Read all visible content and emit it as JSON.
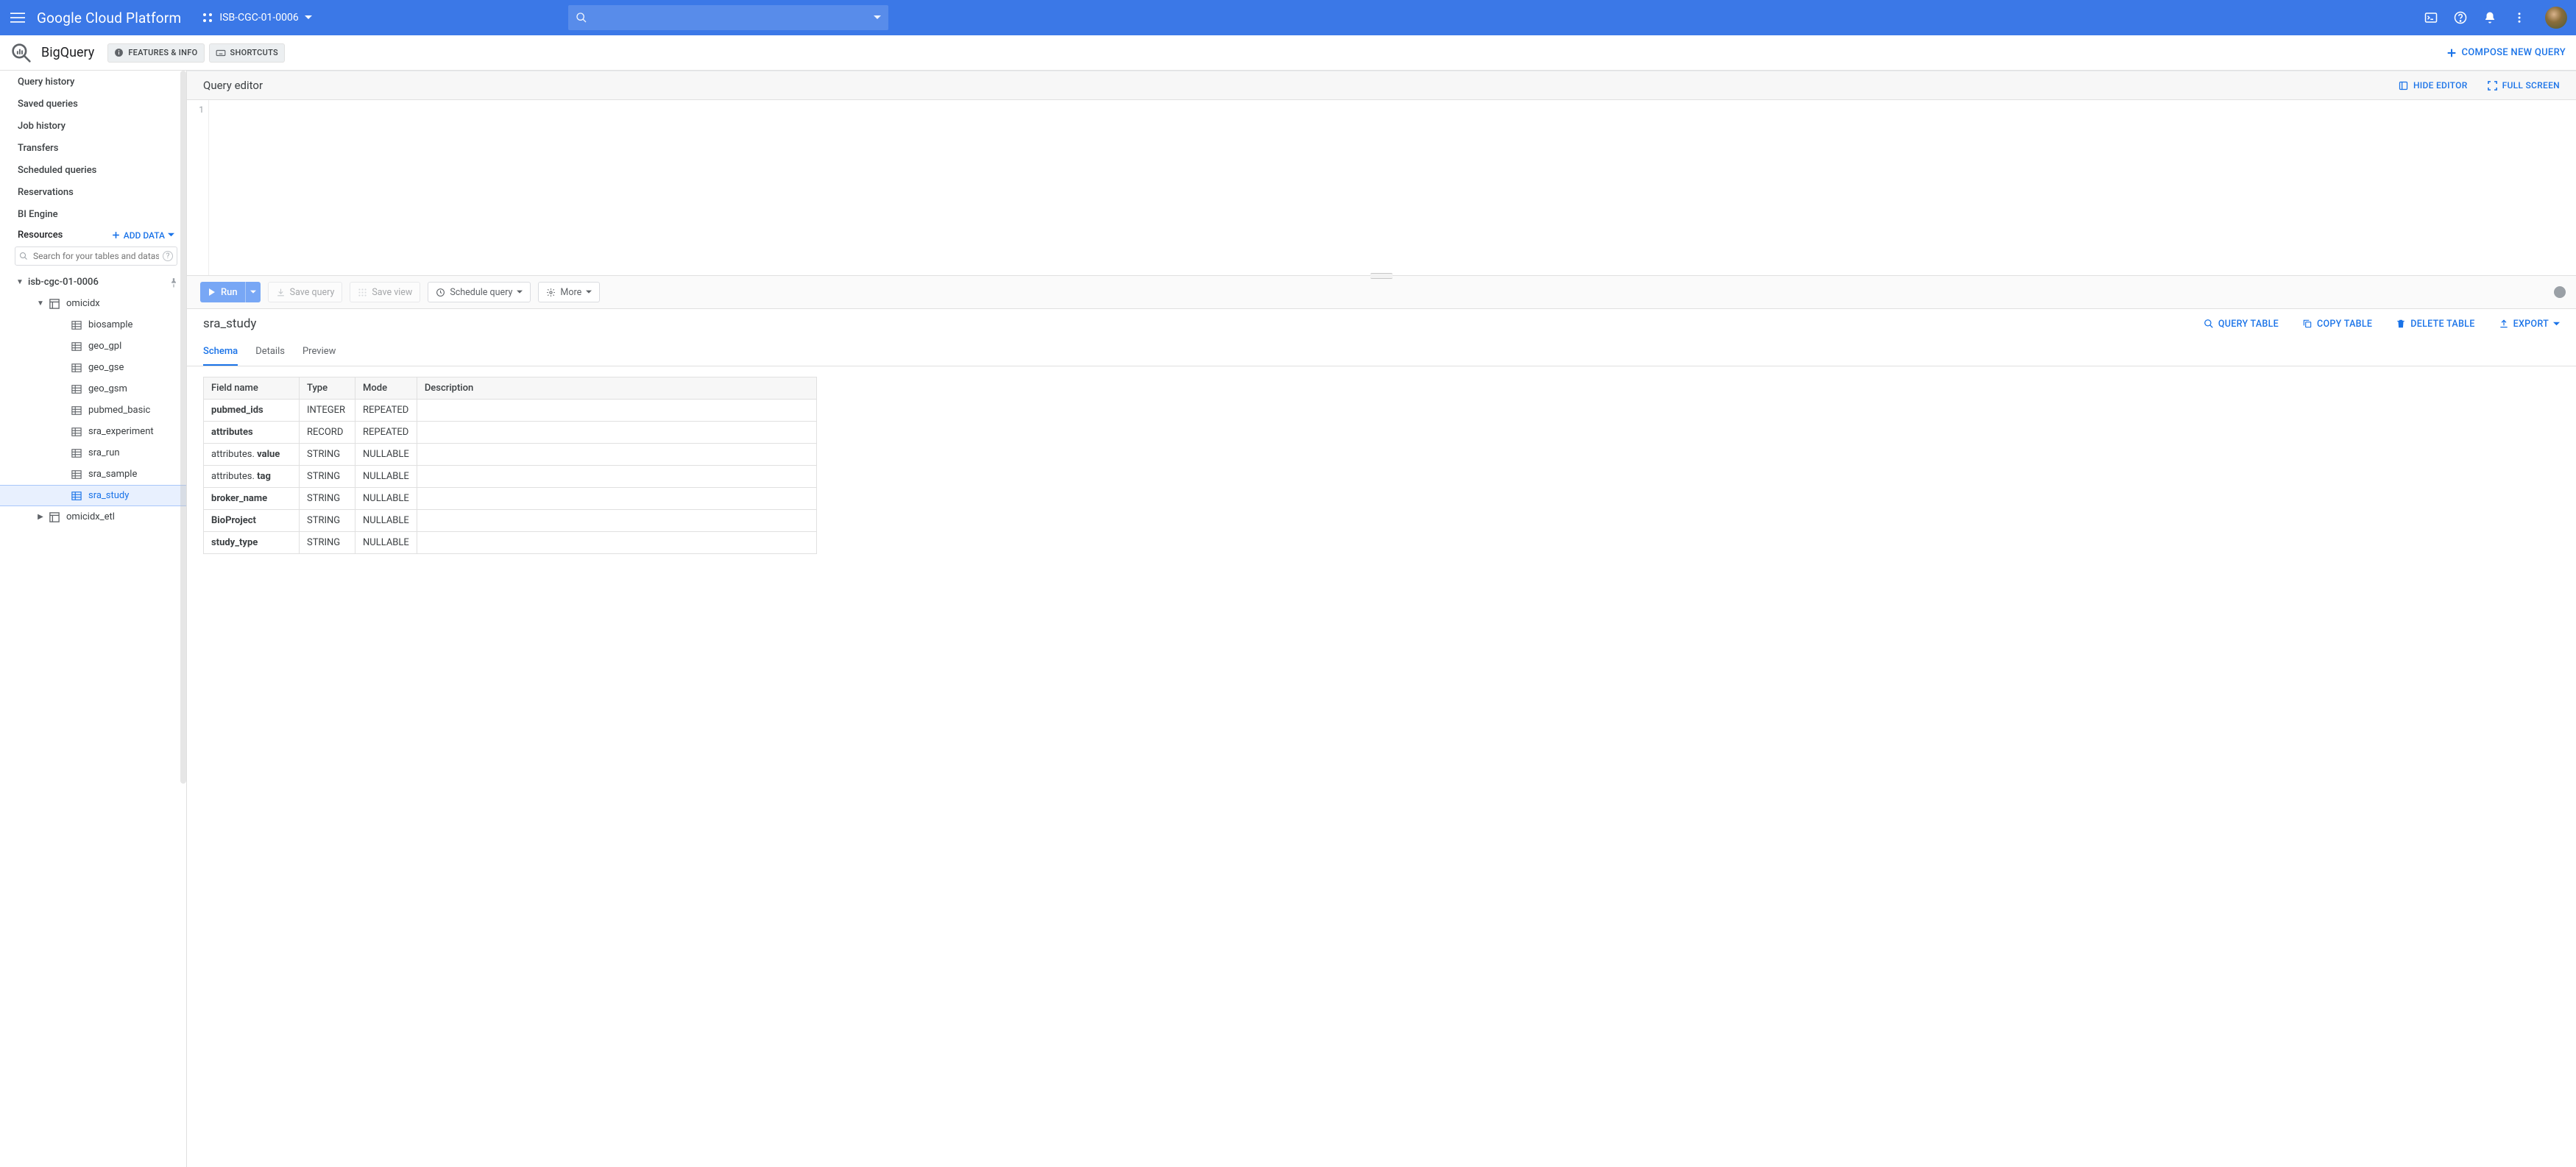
{
  "header": {
    "platform_title": "Google Cloud Platform",
    "project_name": "ISB-CGC-01-0006"
  },
  "service": {
    "title": "BigQuery",
    "features_chip": "FEATURES & INFO",
    "shortcuts_chip": "SHORTCUTS",
    "compose_label": "COMPOSE NEW QUERY"
  },
  "sidebar": {
    "nav": {
      "query_history": "Query history",
      "saved_queries": "Saved queries",
      "job_history": "Job history",
      "transfers": "Transfers",
      "scheduled_queries": "Scheduled queries",
      "reservations": "Reservations",
      "bi_engine": "BI Engine"
    },
    "resources_label": "Resources",
    "add_data_label": "ADD DATA",
    "search_placeholder": "Search for your tables and datas…",
    "tree": {
      "project": "isb-cgc-01-0006",
      "dataset1": "omicidx",
      "tables": {
        "biosample": "biosample",
        "geo_gpl": "geo_gpl",
        "geo_gse": "geo_gse",
        "geo_gsm": "geo_gsm",
        "pubmed_basic": "pubmed_basic",
        "sra_experiment": "sra_experiment",
        "sra_run": "sra_run",
        "sra_sample": "sra_sample",
        "sra_study": "sra_study"
      },
      "dataset2": "omicidx_etl"
    }
  },
  "editor": {
    "title": "Query editor",
    "hide_label": "HIDE EDITOR",
    "fullscreen_label": "FULL SCREEN",
    "line1": "1"
  },
  "toolbar": {
    "run": "Run",
    "save_query": "Save query",
    "save_view": "Save view",
    "schedule": "Schedule query",
    "more": "More"
  },
  "table_panel": {
    "title": "sra_study",
    "query_table": "QUERY TABLE",
    "copy_table": "COPY TABLE",
    "delete_table": "DELETE TABLE",
    "export": "EXPORT",
    "tabs": {
      "schema": "Schema",
      "details": "Details",
      "preview": "Preview"
    },
    "columns": {
      "field": "Field name",
      "type": "Type",
      "mode": "Mode",
      "desc": "Description"
    },
    "rows": {
      "r0": {
        "name": "pubmed_ids",
        "type": "INTEGER",
        "mode": "REPEATED",
        "desc": ""
      },
      "r1": {
        "name": "attributes",
        "type": "RECORD",
        "mode": "REPEATED",
        "desc": ""
      },
      "r2": {
        "prefix": "attributes. ",
        "name": "value",
        "type": "STRING",
        "mode": "NULLABLE",
        "desc": ""
      },
      "r3": {
        "prefix": "attributes. ",
        "name": "tag",
        "type": "STRING",
        "mode": "NULLABLE",
        "desc": ""
      },
      "r4": {
        "name": "broker_name",
        "type": "STRING",
        "mode": "NULLABLE",
        "desc": ""
      },
      "r5": {
        "name": "BioProject",
        "type": "STRING",
        "mode": "NULLABLE",
        "desc": ""
      },
      "r6": {
        "name": "study_type",
        "type": "STRING",
        "mode": "NULLABLE",
        "desc": ""
      }
    }
  }
}
